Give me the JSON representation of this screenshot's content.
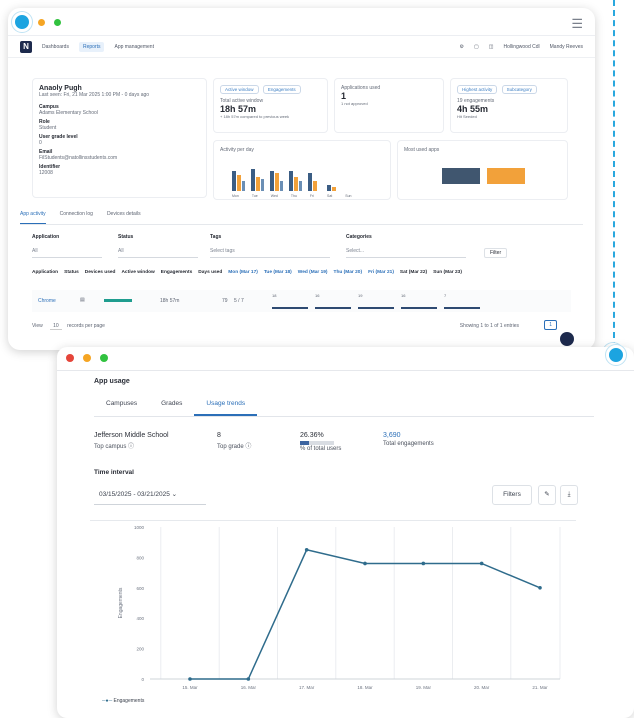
{
  "window1": {
    "nav": {
      "logo": "N",
      "dashboards": "Dashboards",
      "reports": "Reports",
      "app_management": "App management",
      "org": "Hollingwood Cdl",
      "user": "Mandy Reeves"
    },
    "student": {
      "name": "Anaoly Pugh",
      "last_seen": "Last seen: Fri, 21 Mar 2025 1:00 PM - 0 days ago",
      "campus_label": "Campus",
      "campus": "Adams Elementary School",
      "role_label": "Role",
      "role": "Student",
      "grade_label": "User grade level",
      "grade": "0",
      "email_label": "Email",
      "email": "FilStudents@natollinsstudents.com",
      "id_label": "Identifier",
      "id": "12008"
    },
    "active_window": {
      "tab1": "Active window",
      "tab2": "Engagements",
      "title": "Total active window",
      "value": "18h 57m",
      "note": "+ 18h 57m compared to previous week"
    },
    "apps_used": {
      "title": "Applications used",
      "value": "1",
      "note": "1 not approved"
    },
    "engagements": {
      "tab1": "Highest activity",
      "tab2": "Subcategory",
      "count": "19 engagements",
      "value": "4h 55m",
      "note": "Hit Seeded"
    },
    "activity_title": "Activity per day",
    "activity_days": [
      "Mon",
      "Tue",
      "Wed",
      "Thu",
      "Fri",
      "Sat",
      "Sun"
    ],
    "most_used_title": "Most used apps",
    "tabs": [
      "App activity",
      "Connection log",
      "Devices details"
    ],
    "filters": {
      "application_label": "Application",
      "application_value": "All",
      "status_label": "Status",
      "status_value": "All",
      "tags_label": "Tags",
      "tags_placeholder": "Select tags",
      "categories_label": "Categories",
      "categories_placeholder": "Select...",
      "filter_button": "Filter"
    },
    "table_headers": [
      "Application",
      "Status",
      "Devices used",
      "Active window",
      "Engagements",
      "Days used",
      "Mon (Mar 17)",
      "Tue (Mar 18)",
      "Wed (Mar 19)",
      "Thu (Mar 20)",
      "Fri (Mar 21)",
      "Sat (Mar 22)",
      "Sun (Mar 23)"
    ],
    "row": {
      "app": "Chrome",
      "active": "18h 57m",
      "engagements": "79",
      "days": "5 / 7",
      "cells": [
        "18",
        "16",
        "19",
        "16",
        "7"
      ]
    },
    "footer": {
      "view": "View",
      "per_page": "10",
      "records": "records per page",
      "showing": "Showing 1 to 1 of 1 entries",
      "page": "1"
    }
  },
  "window2": {
    "section_title": "App usage",
    "tabs": [
      "Campuses",
      "Grades",
      "Usage trends"
    ],
    "active_tab": "Usage trends",
    "stats": {
      "campus": "Jefferson Middle School",
      "campus_label": "Top campus",
      "grade": "8",
      "grade_label": "Top grade",
      "percent": "26.36%",
      "percent_label": "% of total users",
      "percent_fraction": 0.2636,
      "engagements": "3,690",
      "engagements_label": "Total engagements"
    },
    "time_interval_label": "Time interval",
    "date_range": "03/15/2025 - 03/21/2025",
    "filters_button": "Filters",
    "legend": "Engagements"
  },
  "chart_data": {
    "type": "line",
    "x": [
      "15. Mar",
      "16. Mar",
      "17. Mar",
      "18. Mar",
      "19. Mar",
      "20. Mar",
      "21. Mar"
    ],
    "series": [
      {
        "name": "Engagements",
        "values": [
          0,
          0,
          850,
          760,
          760,
          760,
          600
        ]
      }
    ],
    "ylabel": "Engagements",
    "yticks": [
      0,
      200,
      400,
      600,
      800,
      1000
    ],
    "ylim": [
      0,
      1000
    ],
    "grid": true,
    "legend": "bottom-left",
    "colors": {
      "line": "#2f6c8c"
    }
  }
}
